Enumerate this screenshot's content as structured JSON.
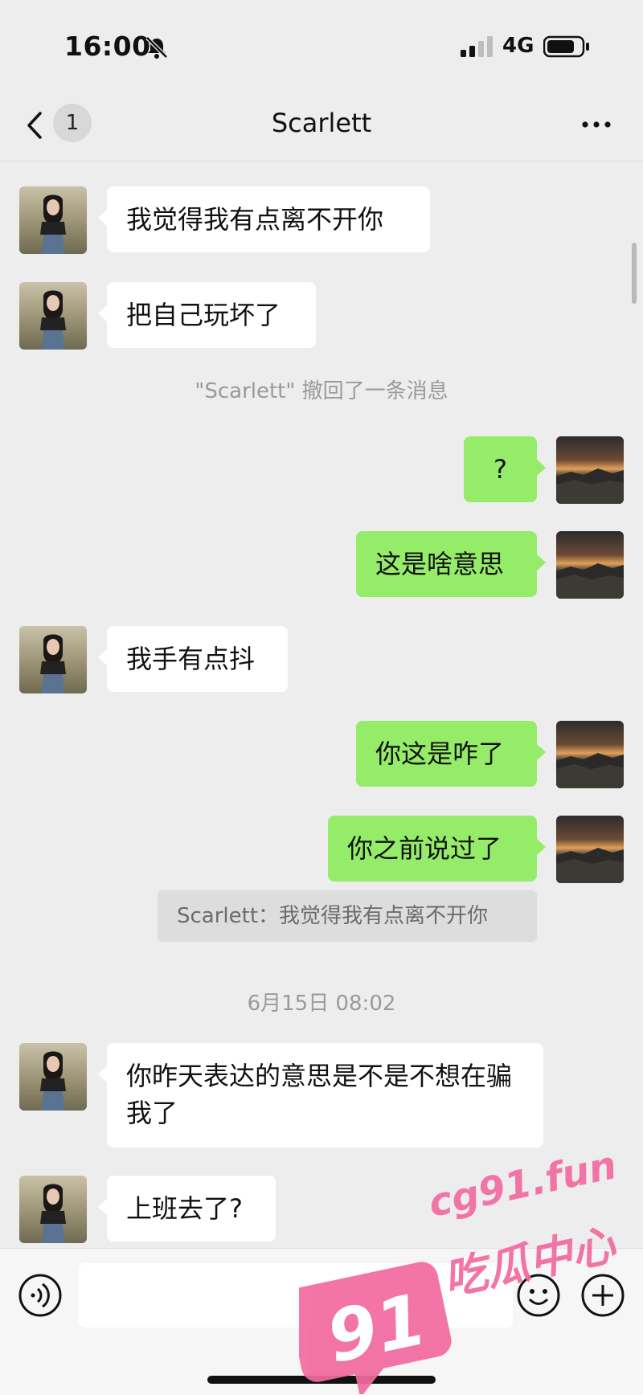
{
  "status_bar": {
    "time": "16:00",
    "network": "4G"
  },
  "nav": {
    "unread_count": "1",
    "title": "Scarlett"
  },
  "messages": [
    {
      "side": "in",
      "text": "我觉得我有点离不开你"
    },
    {
      "side": "in",
      "text": "把自己玩坏了"
    },
    {
      "side": "system",
      "text": "\"Scarlett\" 撤回了一条消息"
    },
    {
      "side": "out",
      "text": "?"
    },
    {
      "side": "out",
      "text": "这是啥意思"
    },
    {
      "side": "in",
      "text": "我手有点抖"
    },
    {
      "side": "out",
      "text": "你这是咋了"
    },
    {
      "side": "out",
      "text": "你之前说过了"
    },
    {
      "side": "quote",
      "text": "Scarlett：我觉得我有点离不开你"
    },
    {
      "side": "timestamp",
      "text": "6月15日 08:02"
    },
    {
      "side": "in",
      "text": "你昨天表达的意思是不是不想在骗我了"
    },
    {
      "side": "in",
      "text": "上班去了?"
    }
  ],
  "watermark": {
    "number": "91",
    "site": "cg91.fun",
    "slogan": "吃瓜中心"
  },
  "colors": {
    "background": "#ededed",
    "outgoing_bubble": "#95ec69",
    "incoming_bubble": "#ffffff",
    "watermark": "#f26aa0"
  }
}
